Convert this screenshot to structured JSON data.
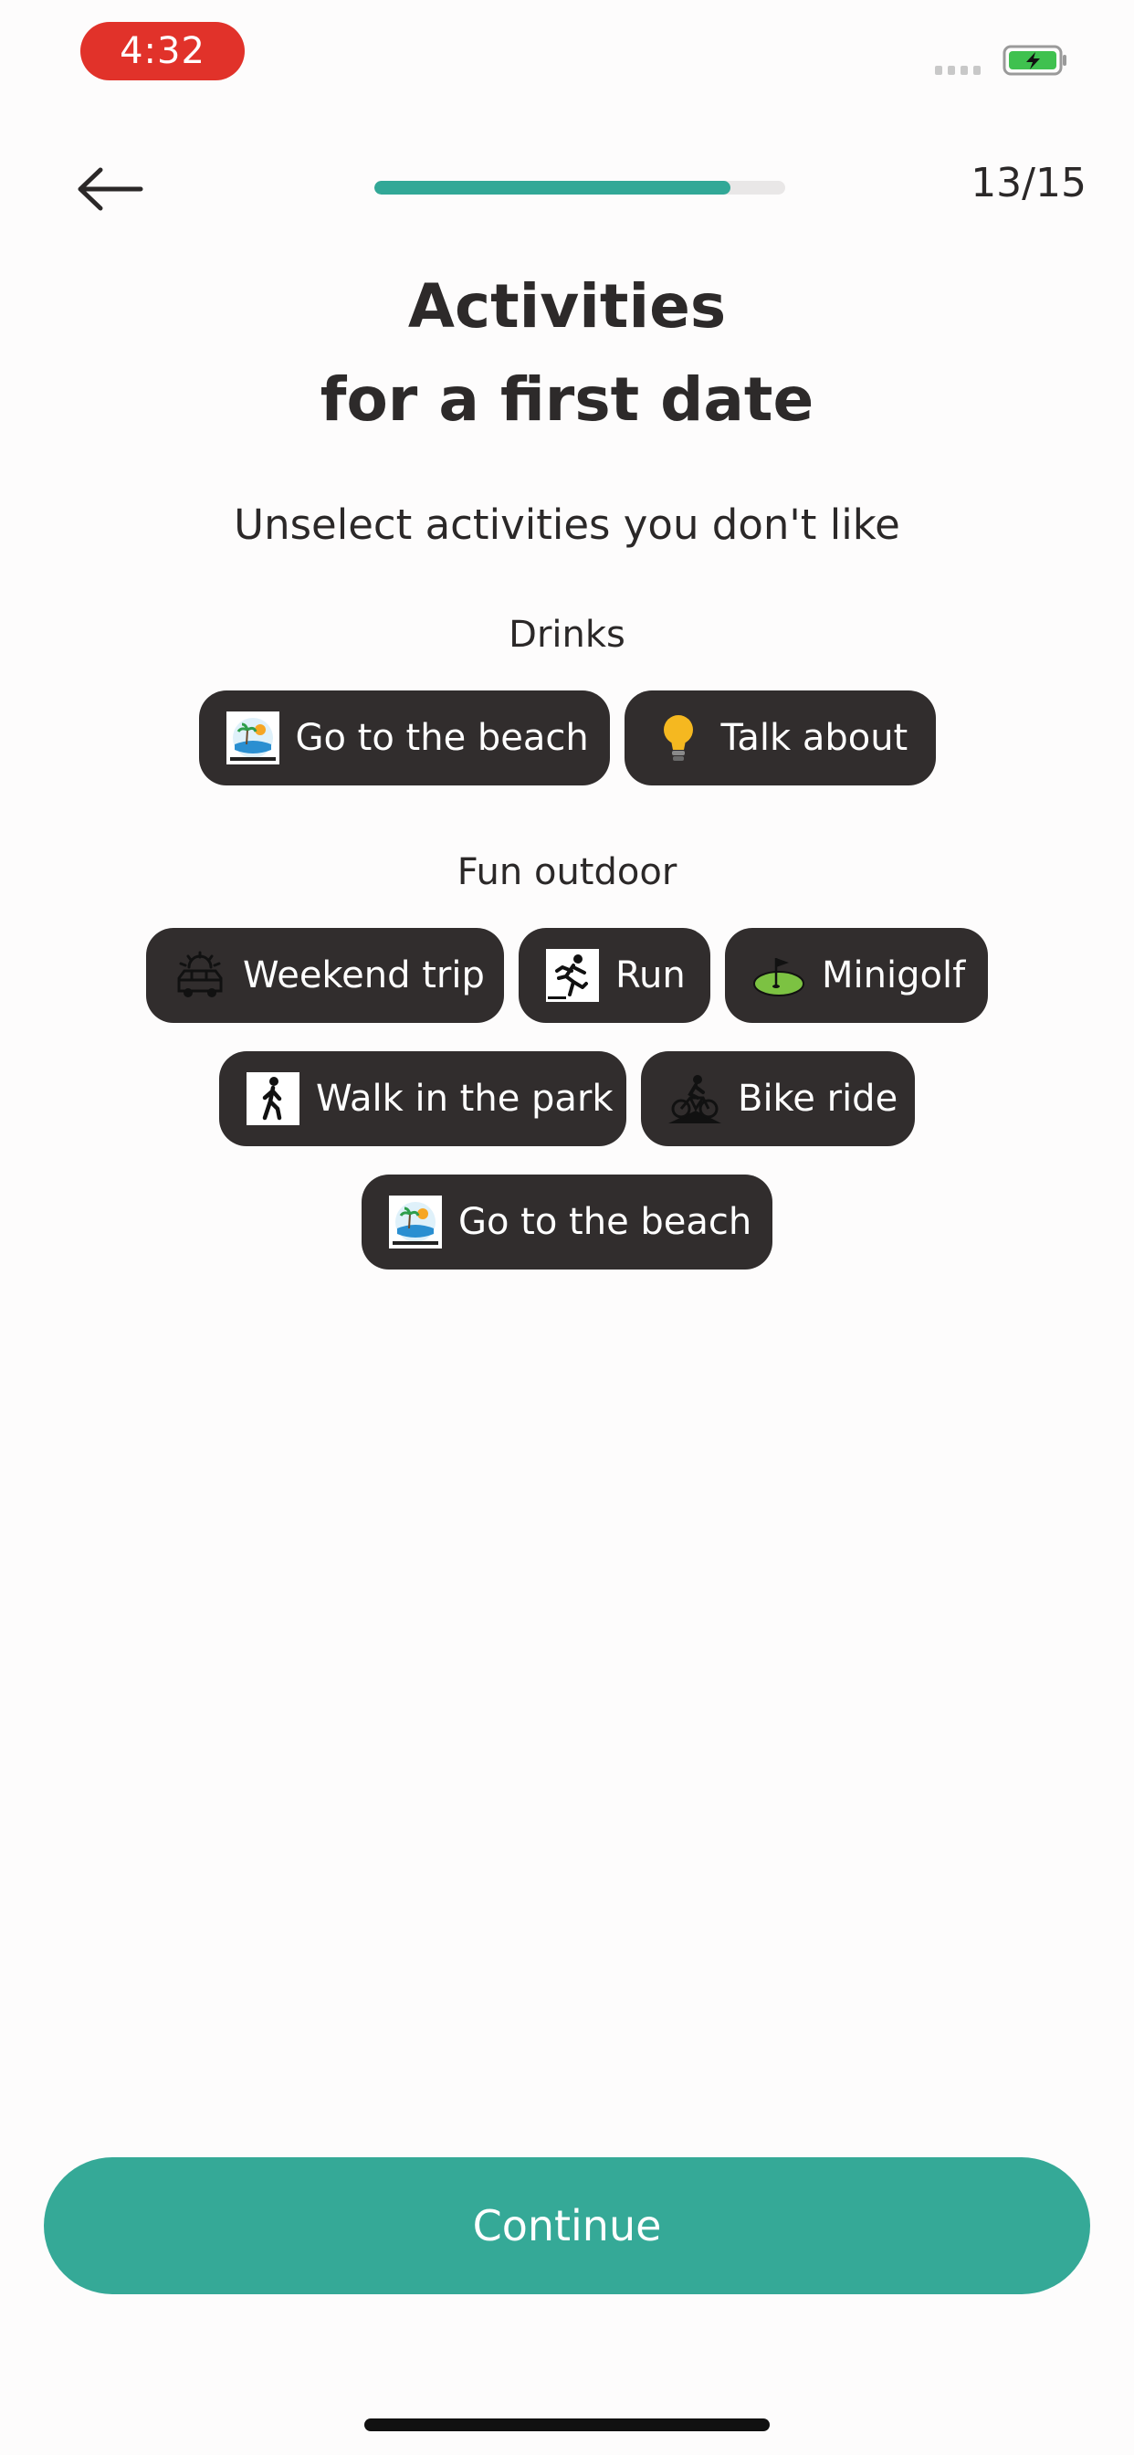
{
  "status_bar": {
    "time": "4:32"
  },
  "header": {
    "step_label": "13/15",
    "progress_fraction": 0.866
  },
  "title": {
    "line1": "Activities",
    "line2": "for a first date"
  },
  "subtitle": "Unselect activities you don't like",
  "sections": [
    {
      "label": "Drinks",
      "chips": [
        {
          "label": "Go to the beach",
          "icon": "beach-island-icon"
        },
        {
          "label": "Talk about",
          "icon": "lightbulb-icon"
        }
      ]
    },
    {
      "label": "Fun outdoor",
      "chips": [
        {
          "label": "Weekend trip",
          "icon": "van-sunrise-icon"
        },
        {
          "label": "Run",
          "icon": "runner-icon"
        },
        {
          "label": "Minigolf",
          "icon": "golf-flag-icon"
        },
        {
          "label": "Walk in the park",
          "icon": "pedestrian-icon"
        },
        {
          "label": "Bike ride",
          "icon": "mountain-bike-icon"
        },
        {
          "label": "Go to the beach",
          "icon": "beach-island-icon"
        }
      ]
    }
  ],
  "continue_label": "Continue",
  "colors": {
    "accent": "#35a997",
    "chip_bg": "#312d2d",
    "time_pill": "#e1322a",
    "battery": "#3fc14f"
  }
}
